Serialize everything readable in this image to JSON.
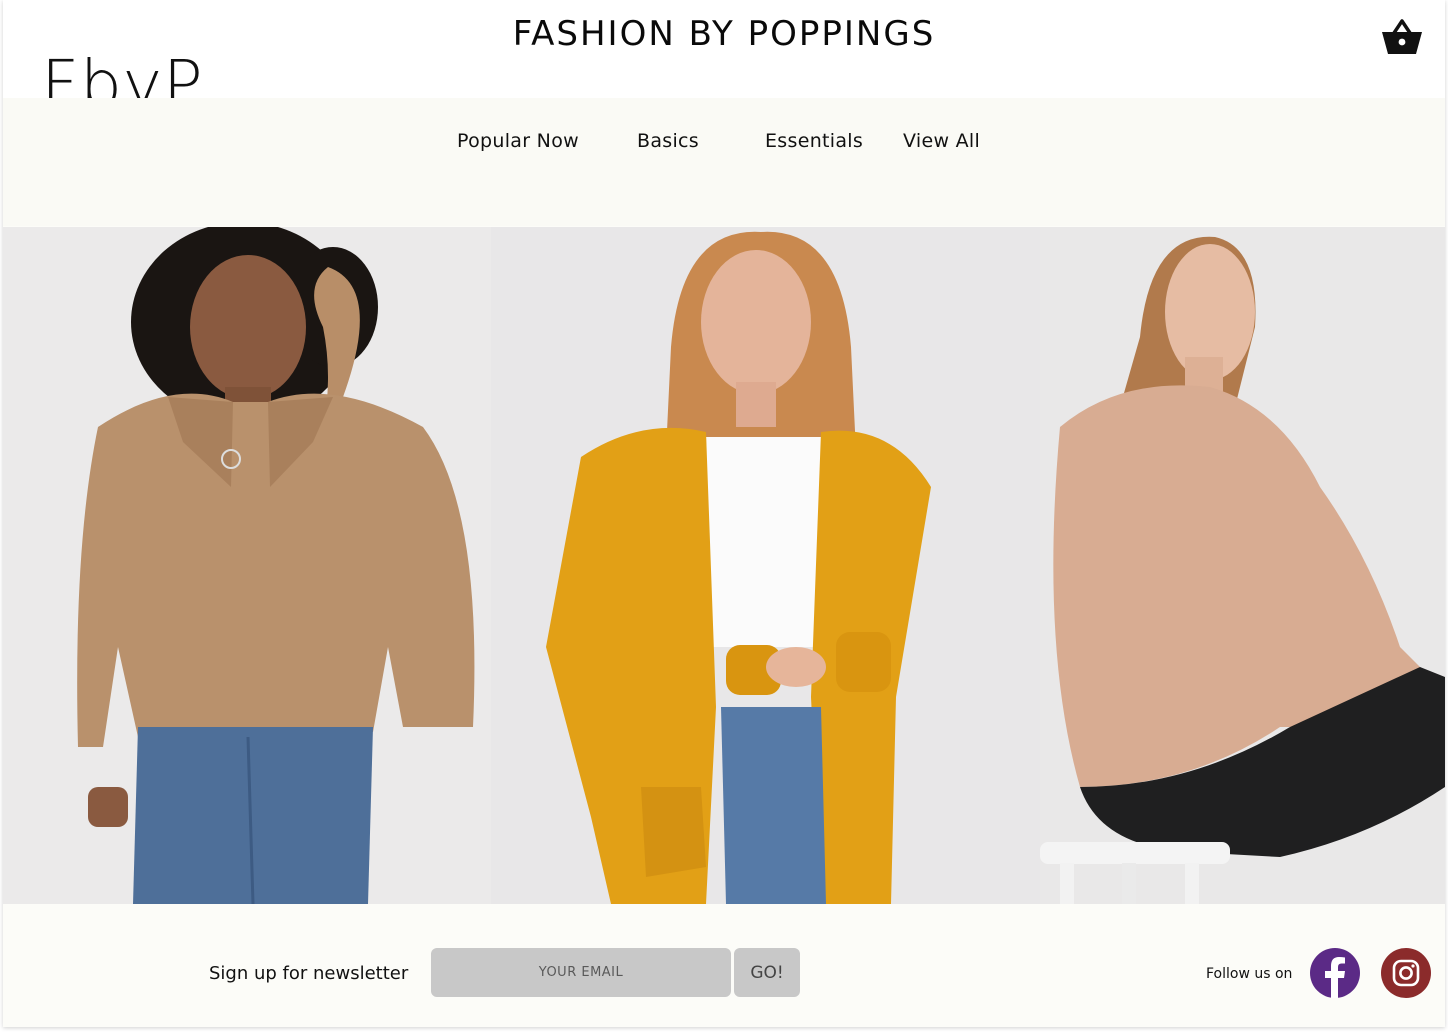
{
  "header": {
    "title": "FASHION BY POPPINGS",
    "logo_text": "FbyP",
    "cart_icon": "basket-icon"
  },
  "nav": {
    "items": [
      {
        "label": "Popular Now"
      },
      {
        "label": "Basics"
      },
      {
        "label": "Essentials"
      },
      {
        "label": "View All"
      }
    ]
  },
  "hero": {
    "images": [
      {
        "name": "model-tan-zip-sweater"
      },
      {
        "name": "model-yellow-cardigan"
      },
      {
        "name": "model-pink-sweatshirt-seated"
      }
    ]
  },
  "footer": {
    "newsletter_label": "Sign up for newsletter",
    "email_placeholder": "YOUR EMAIL",
    "go_label": "GO!",
    "follow_label": "Follow us on",
    "social": [
      {
        "icon": "facebook-icon",
        "color": "#5b2a86"
      },
      {
        "icon": "instagram-icon",
        "color": "#8b2b2b"
      }
    ]
  },
  "colors": {
    "background": "#fcfcf8",
    "input_gray": "#c8c8c8",
    "facebook": "#5b2a86",
    "instagram": "#8b2b2b"
  }
}
